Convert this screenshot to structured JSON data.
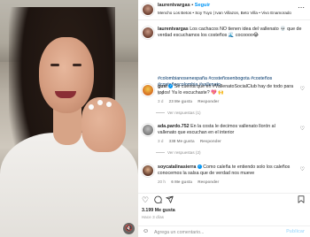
{
  "header": {
    "username": "laurentvargas",
    "separator": "•",
    "follow_label": "Seguir",
    "audio": "Mencho Los Betos • Soy Tuyo | Ivan Villazon, Beto Villa • Vivo Enamorado",
    "more_icon": "more-horizontal-icon"
  },
  "caption": {
    "username": "laurentvargas",
    "text": "Los cachacos NO tienen idea del vallenato 💀 que de verdad escuchamos los costeños 🌊 cocoooo😂",
    "hashtags": "#colombianosenespaña #costeñosenbogota #costeños #costeñoscolombia #vallenato",
    "time": "3 d"
  },
  "comments": [
    {
      "username": "gusi",
      "verified": true,
      "text": "Se cuenta que en #VallenatoSocialClub hay de todo para todos! Ya lo escuchaste? 💖 🙌",
      "time": "3 d",
      "likes": "23 Me gusta",
      "reply_label": "Responder",
      "replies_label": "Ver respuestas (1)"
    },
    {
      "username": "ada.pardo.752",
      "verified": false,
      "text": "En la costa le decimos vallenato llorón al vallenato que escuchan en el interior",
      "time": "3 d",
      "likes": "338 Me gusta",
      "reply_label": "Responder",
      "replies_label": "Ver respuestas (2)"
    },
    {
      "username": "soycatalinasierra",
      "verified": true,
      "text": "Como caleña te entiendo solo los caleños conocemos la salsa que de verdad nos mueve",
      "time": "20 h",
      "likes": "6 Me gusta",
      "reply_label": "Responder"
    }
  ],
  "actions": {
    "like_icon": "heart-icon",
    "comment_icon": "comment-icon",
    "share_icon": "share-icon",
    "save_icon": "bookmark-icon"
  },
  "likes_count": "3.199 Me gusta",
  "posted": "Hace 3 días",
  "composer": {
    "emoji_icon": "emoji-icon",
    "placeholder": "Agrega un comentario...",
    "publish_label": "Publicar"
  }
}
